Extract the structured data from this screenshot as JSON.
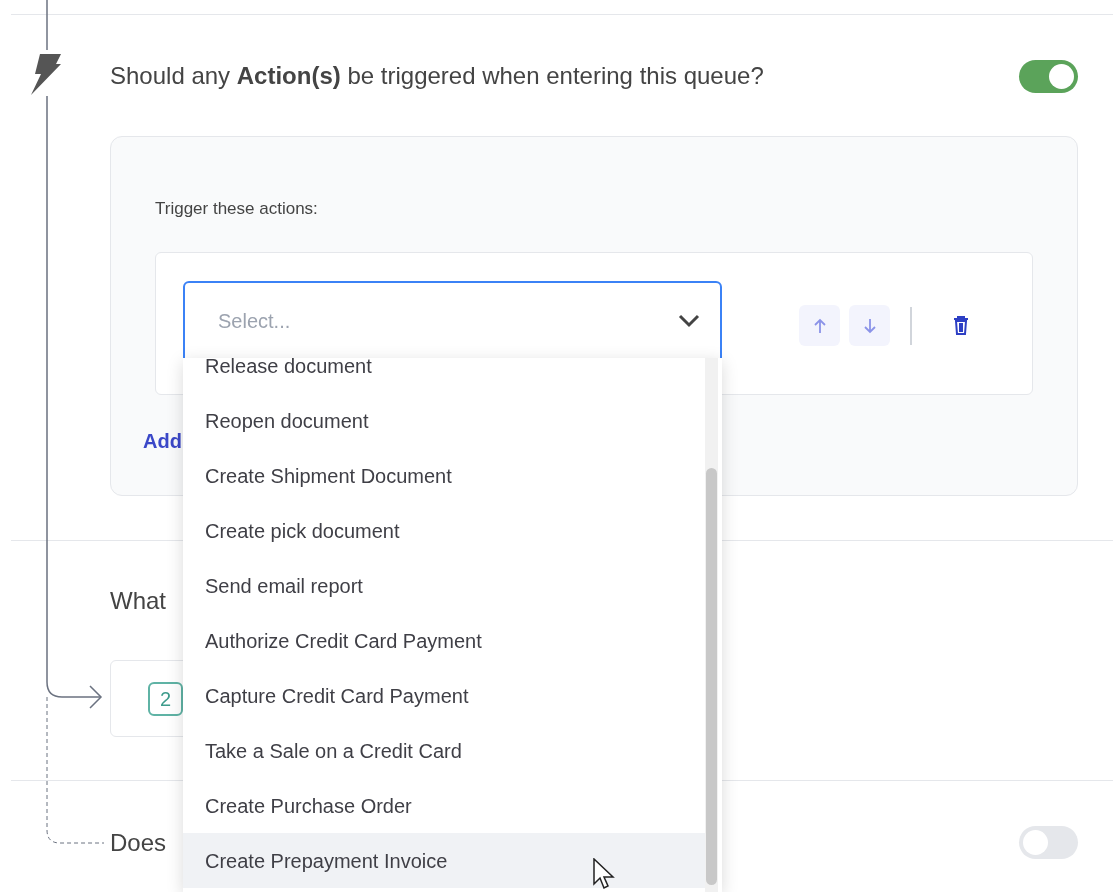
{
  "trigger_section": {
    "question": "Should any **Action(s)** be triggered when entering this queue?",
    "toggle_on": true,
    "card": {
      "label": "Trigger these actions:",
      "select": {
        "placeholder": "Select..."
      },
      "add_link": "Add"
    }
  },
  "next_section": {
    "question": "What",
    "step_badge": "2"
  },
  "last_section": {
    "question": "Does",
    "toggle_on": false
  },
  "dropdown": {
    "items": [
      {
        "label": "Release document",
        "hovered": false
      },
      {
        "label": "Reopen document",
        "hovered": false
      },
      {
        "label": "Create Shipment Document",
        "hovered": false
      },
      {
        "label": "Create pick document",
        "hovered": false
      },
      {
        "label": "Send email report",
        "hovered": false
      },
      {
        "label": "Authorize Credit Card Payment",
        "hovered": false
      },
      {
        "label": "Capture Credit Card Payment",
        "hovered": false
      },
      {
        "label": "Take a Sale on a Credit Card",
        "hovered": false
      },
      {
        "label": "Create Purchase Order",
        "hovered": false
      },
      {
        "label": "Create Prepayment Invoice",
        "hovered": true
      }
    ]
  }
}
